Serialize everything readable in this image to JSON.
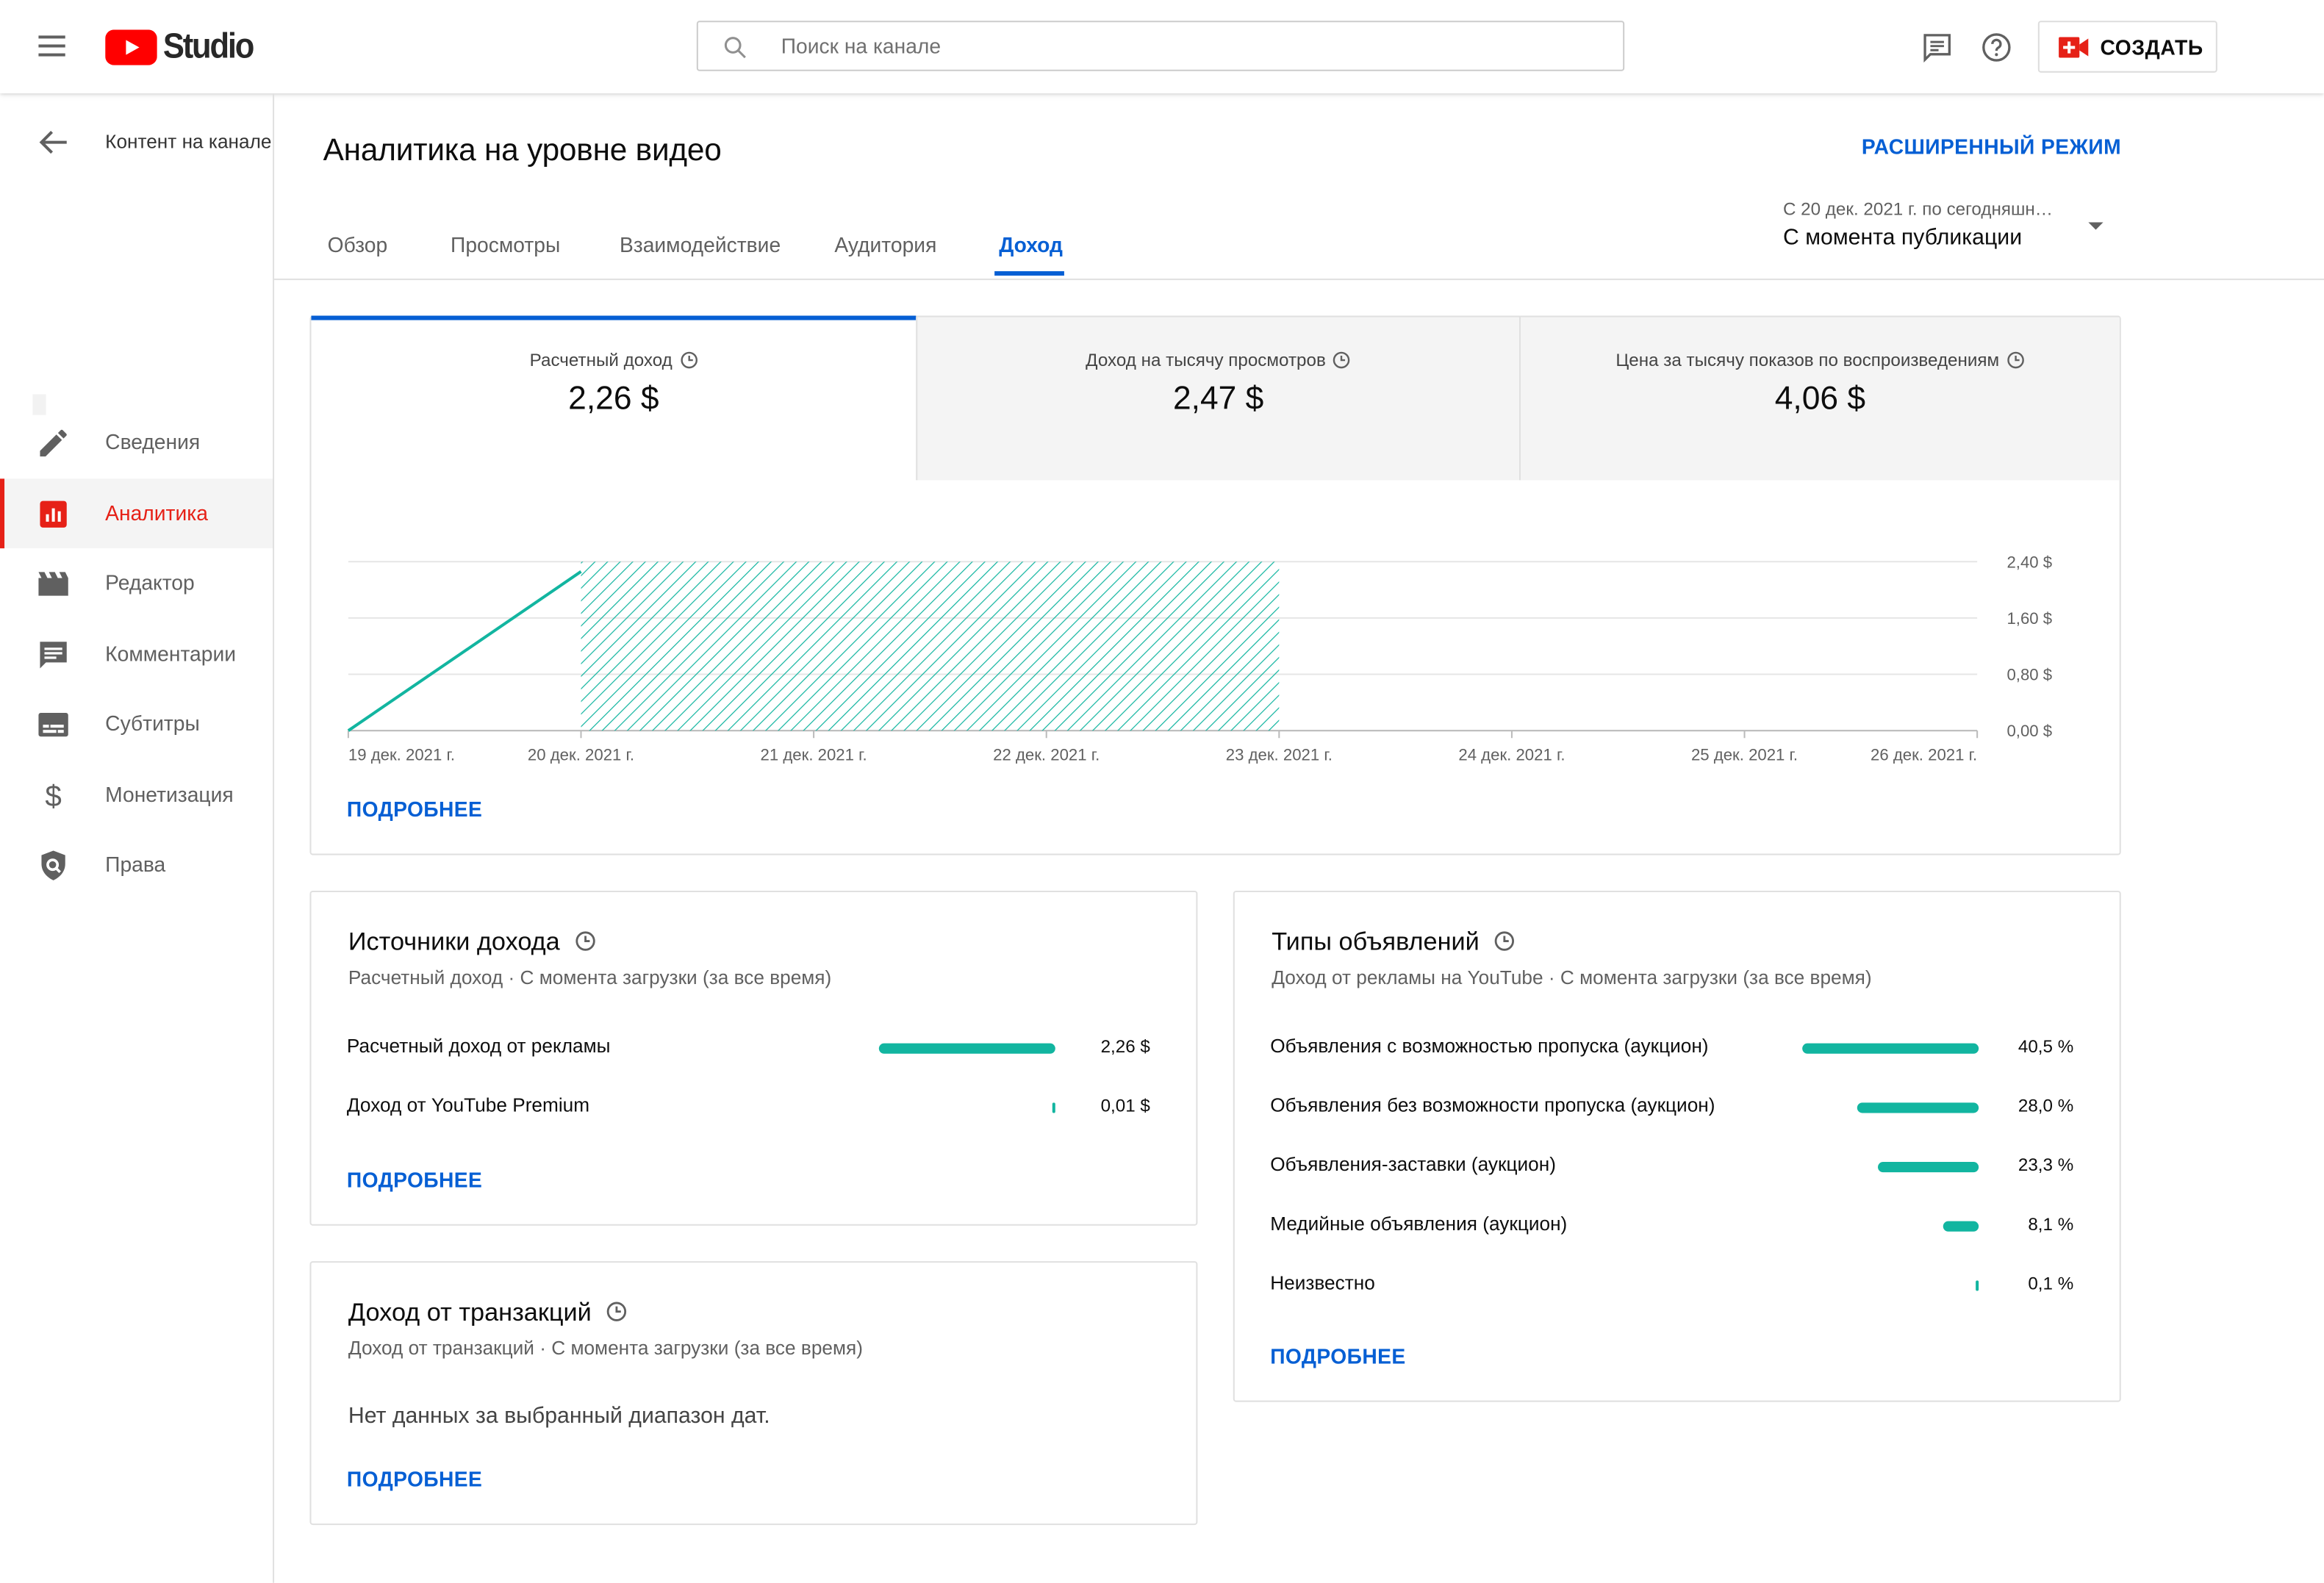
{
  "header": {
    "logo_text": "Studio",
    "search_placeholder": "Поиск на канале",
    "create_label": "СОЗДАТЬ"
  },
  "sidebar": {
    "channel_label": "Контент на канале",
    "items": [
      {
        "label": "Сведения",
        "icon": "pencil-icon",
        "active": false
      },
      {
        "label": "Аналитика",
        "icon": "analytics-icon",
        "active": true
      },
      {
        "label": "Редактор",
        "icon": "clapperboard-icon",
        "active": false
      },
      {
        "label": "Комментарии",
        "icon": "comment-icon",
        "active": false
      },
      {
        "label": "Субтитры",
        "icon": "subtitles-icon",
        "active": false
      },
      {
        "label": "Монетизация",
        "icon": "dollar-icon",
        "active": false
      },
      {
        "label": "Права",
        "icon": "copyright-shield-icon",
        "active": false
      }
    ]
  },
  "page": {
    "title": "Аналитика на уровне видео",
    "advanced_mode": "РАСШИРЕННЫЙ РЕЖИМ",
    "tabs": [
      "Обзор",
      "Просмотры",
      "Взаимодействие",
      "Аудитория",
      "Доход"
    ],
    "active_tab": "Доход",
    "date_range": "С 20 дек. 2021 г. по сегодняшн…",
    "date_value": "С момента публикации"
  },
  "metrics": [
    {
      "label": "Расчетный доход",
      "value": "2,26 $"
    },
    {
      "label": "Доход на тысячу просмотров",
      "value": "2,47 $"
    },
    {
      "label": "Цена за тысячу показов по воспроизведениям",
      "value": "4,06 $"
    }
  ],
  "chart_data": {
    "type": "line",
    "x": [
      "19 дек. 2021 г.",
      "20 дек. 2021 г.",
      "21 дек. 2021 г.",
      "22 дек. 2021 г.",
      "23 дек. 2021 г.",
      "24 дек. 2021 г.",
      "25 дек. 2021 г.",
      "26 дек. 2021 г."
    ],
    "series": [
      {
        "values": [
          0,
          2.26,
          null,
          null,
          null,
          null,
          null,
          null
        ]
      }
    ],
    "estimated_range": [
      "20 дек. 2021 г.",
      "23 дек. 2021 г."
    ],
    "y_ticks": [
      "0,00 $",
      "0,80 $",
      "1,60 $",
      "2,40 $"
    ],
    "y_tick_values": [
      0,
      0.8,
      1.6,
      2.4
    ],
    "ylim": [
      0,
      2.4
    ],
    "x_tick_labels": [
      "19 дек. 2021 г.",
      "20 дек. 2021 г.",
      "21 дек. 2021 г.",
      "22 дек. 2021 г.",
      "23 дек. 2021 г.",
      "24 дек. 2021 г.",
      "25 дек. 2021 г.",
      "26 дек. 2021 г."
    ],
    "color": "#12b5a0",
    "grid": true
  },
  "chart_more": "ПОДРОБНЕЕ",
  "sources": {
    "title": "Источники дохода",
    "subtitle": "Расчетный доход · С момента загрузки (за все время)",
    "rows": [
      {
        "label": "Расчетный доход от рекламы",
        "value": "2,26 $",
        "amount": 2.26
      },
      {
        "label": "Доход от YouTube Premium",
        "value": "0,01 $",
        "amount": 0.01
      }
    ],
    "more": "ПОДРОБНЕЕ"
  },
  "transactions": {
    "title": "Доход от транзакций",
    "subtitle": "Доход от транзакций · С момента загрузки (за все время)",
    "empty": "Нет данных за выбранный диапазон дат.",
    "more": "ПОДРОБНЕЕ"
  },
  "ad_types": {
    "title": "Типы объявлений",
    "subtitle": "Доход от рекламы на YouTube · С момента загрузки (за все время)",
    "rows": [
      {
        "label": "Объявления с возможностью пропуска (аукцион)",
        "value": "40,5 %",
        "pct": 40.5
      },
      {
        "label": "Объявления без возможности пропуска (аукцион)",
        "value": "28,0 %",
        "pct": 28.0
      },
      {
        "label": "Объявления-заставки (аукцион)",
        "value": "23,3 %",
        "pct": 23.3
      },
      {
        "label": "Медийные объявления (аукцион)",
        "value": "8,1 %",
        "pct": 8.1
      },
      {
        "label": "Неизвестно",
        "value": "0,1 %",
        "pct": 0.1
      }
    ],
    "more": "ПОДРОБНЕЕ"
  },
  "colors": {
    "accent": "#065fd4",
    "brand_red": "#e62117",
    "chart": "#12b5a0"
  }
}
